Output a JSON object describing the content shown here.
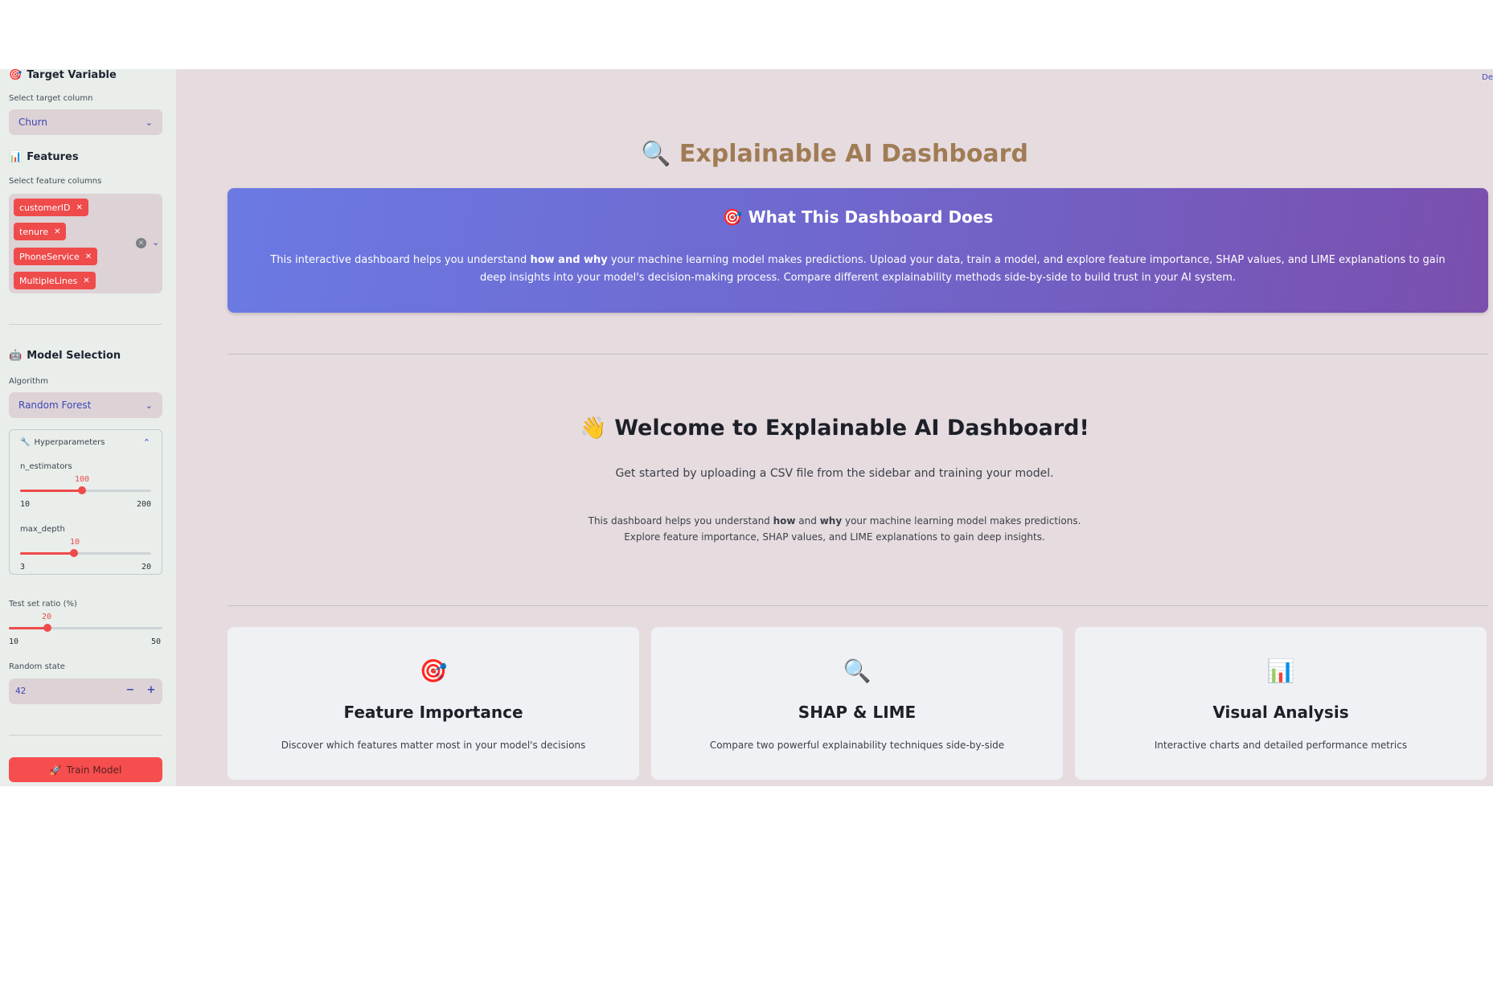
{
  "sidebar": {
    "target": {
      "title": "Target Variable",
      "label": "Select target column",
      "selected": "Churn"
    },
    "features": {
      "title": "Features",
      "label": "Select feature columns",
      "chips": [
        "customerID",
        "tenure",
        "PhoneService",
        "MultipleLines"
      ]
    },
    "model": {
      "title": "Model Selection",
      "algorithm_label": "Algorithm",
      "algorithm": "Random Forest",
      "hyperparameters_title": "Hyperparameters",
      "n_estimators": {
        "label": "n_estimators",
        "value": 100,
        "min": 10,
        "max": 200,
        "value_text": "100",
        "min_text": "10",
        "max_text": "200"
      },
      "max_depth": {
        "label": "max_depth",
        "value": 10,
        "min": 3,
        "max": 20,
        "value_text": "10",
        "min_text": "3",
        "max_text": "20"
      }
    },
    "test_ratio": {
      "label": "Test set ratio (%)",
      "value": 20,
      "min": 10,
      "max": 50,
      "value_text": "20",
      "min_text": "10",
      "max_text": "50"
    },
    "random_state": {
      "label": "Random state",
      "value": "42",
      "minus": "−",
      "plus": "+"
    },
    "train_button": "Train Model"
  },
  "main": {
    "deploy": "De",
    "title": "Explainable AI Dashboard",
    "hero": {
      "title": "What This Dashboard Does",
      "text_before": "This interactive dashboard helps you understand ",
      "text_bold": "how and why",
      "text_after": " your machine learning model makes predictions. Upload your data, train a model, and explore feature importance, SHAP values, and LIME explanations to gain deep insights into your model's decision-making process. Compare different explainability methods side-by-side to build trust in your AI system."
    },
    "welcome": {
      "title": "Welcome to Explainable AI Dashboard!",
      "subtitle": "Get started by uploading a CSV file from the sidebar and training your model.",
      "desc_1": "This dashboard helps you understand ",
      "desc_how": "how",
      "desc_and": " and ",
      "desc_why": "why",
      "desc_2": " your machine learning model makes predictions.",
      "desc_line2": "Explore feature importance, SHAP values, and LIME explanations to gain deep insights."
    },
    "cards": [
      {
        "title": "Feature Importance",
        "text": "Discover which features matter most in your model's decisions",
        "icon": "target-icon"
      },
      {
        "title": "SHAP & LIME",
        "text": "Compare two powerful explainability techniques side-by-side",
        "icon": "magnifier-icon"
      },
      {
        "title": "Visual Analysis",
        "text": "Interactive charts and detailed performance metrics",
        "icon": "bar-chart-icon"
      }
    ]
  },
  "colors": {
    "accent": "#ef4b4b",
    "link": "#3c47b8",
    "title": "#a07c56"
  }
}
